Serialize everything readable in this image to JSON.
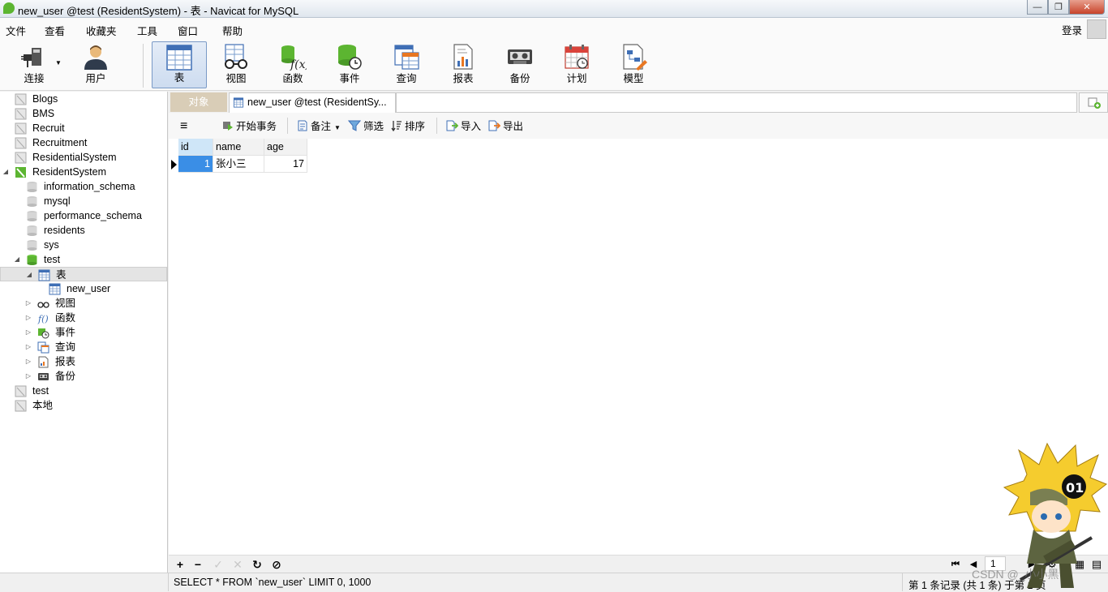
{
  "window": {
    "title": "new_user @test (ResidentSystem) - 表 - Navicat for MySQL"
  },
  "menu": {
    "items": [
      "文件",
      "查看",
      "收藏夹",
      "工具",
      "窗口",
      "帮助"
    ],
    "login": "登录"
  },
  "toolbar": {
    "buttons": [
      {
        "label": "连接",
        "icon": "connection-icon"
      },
      {
        "label": "用户",
        "icon": "user-icon"
      },
      {
        "label": "表",
        "icon": "table-icon",
        "active": true
      },
      {
        "label": "视图",
        "icon": "view-glasses-icon"
      },
      {
        "label": "函数",
        "icon": "function-icon"
      },
      {
        "label": "事件",
        "icon": "event-icon"
      },
      {
        "label": "查询",
        "icon": "query-icon"
      },
      {
        "label": "报表",
        "icon": "report-icon"
      },
      {
        "label": "备份",
        "icon": "backup-icon"
      },
      {
        "label": "计划",
        "icon": "schedule-icon"
      },
      {
        "label": "模型",
        "icon": "model-icon"
      }
    ]
  },
  "sidebar": {
    "connections": [
      {
        "label": "Blogs"
      },
      {
        "label": "BMS"
      },
      {
        "label": "Recruit"
      },
      {
        "label": "Recruitment"
      },
      {
        "label": "ResidentialSystem"
      },
      {
        "label": "ResidentSystem"
      }
    ],
    "databases": [
      {
        "label": "information_schema"
      },
      {
        "label": "mysql"
      },
      {
        "label": "performance_schema"
      },
      {
        "label": "residents"
      },
      {
        "label": "sys"
      },
      {
        "label": "test"
      }
    ],
    "test_children": {
      "tables": "表",
      "table_item": "new_user",
      "views": "视图",
      "functions": "函数",
      "events": "事件",
      "queries": "查询",
      "reports": "报表",
      "backups": "备份"
    },
    "other_connections": [
      {
        "label": "test"
      },
      {
        "label": "本地"
      }
    ]
  },
  "tabs": {
    "objects": "对象",
    "active": "new_user @test (ResidentSy..."
  },
  "content_toolbar": {
    "menu": "≡",
    "begin_transaction": "开始事务",
    "note": "备注",
    "filter": "筛选",
    "sort": "排序",
    "import": "导入",
    "export": "导出"
  },
  "grid": {
    "columns": [
      "id",
      "name",
      "age"
    ],
    "rows": [
      [
        "1",
        "张小三",
        "17"
      ]
    ]
  },
  "bottom": {
    "add": "+",
    "remove": "−",
    "apply": "✓",
    "discard": "✕",
    "refresh": "↻",
    "stop": "⊘",
    "page": "1"
  },
  "status": {
    "sql": "SELECT * FROM `new_user` LIMIT 0, 1000",
    "records": "第 1 条记录 (共 1 条) 于第 1 页"
  },
  "watermark": "CSDN @_小小黑",
  "colors": {
    "selection": "#3a8ee6",
    "header_selected": "#cfe6f8",
    "db_green": "#5cb531"
  }
}
